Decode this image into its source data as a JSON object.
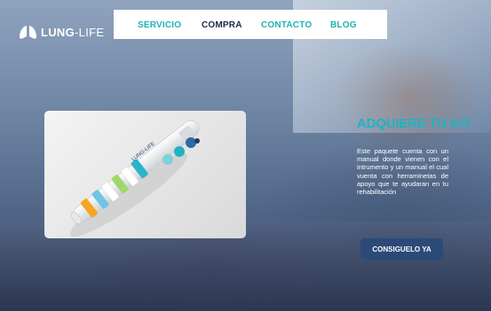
{
  "brand": {
    "name_bold": "LUNG",
    "name_rest": "-LIFE"
  },
  "nav": {
    "items": [
      {
        "label": "SERVICIO"
      },
      {
        "label": "COMPRA"
      },
      {
        "label": "CONTACTO"
      },
      {
        "label": "BLOG"
      }
    ]
  },
  "product": {
    "device_logo": "LUNG-LIFE"
  },
  "hero": {
    "headline": "ADQUIERE TU KIT",
    "description": "Este paquete cuenta con un manual donde vienen con el intrumento y un manual el cual vuenta con herraminetas de apoyo que te ayudaran en tu rehabilitación",
    "cta_label": "CONSIGUELO YA"
  },
  "colors": {
    "accent": "#1fb3b3",
    "nav_active": "#1b2a4a",
    "cta": "#2c4a78"
  }
}
